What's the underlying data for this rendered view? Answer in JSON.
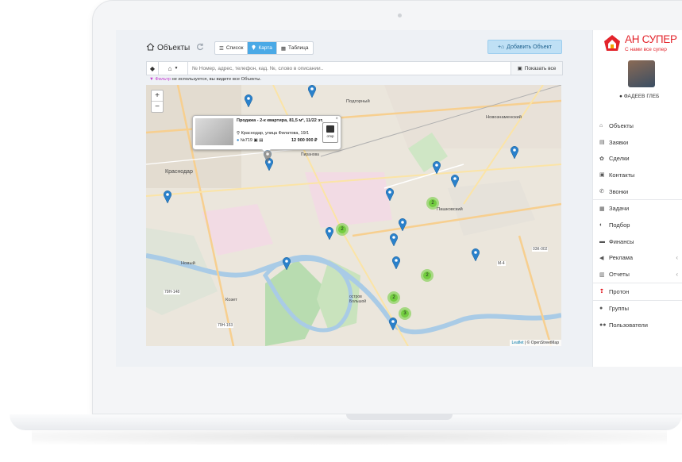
{
  "header": {
    "title": "Объекты",
    "views": [
      {
        "label": "Список"
      },
      {
        "label": "Карта"
      },
      {
        "label": "Таблица"
      }
    ],
    "active_view": "Карта",
    "add_button": "Добавить Объект"
  },
  "search": {
    "placeholder": "№ Номер, адрес, телефон, кад. №, слово в описании..",
    "show_all": "Показать все"
  },
  "filter": {
    "word": "Фильтр",
    "text": "не используется, вы видите все Объекты."
  },
  "map": {
    "zoom_in": "+",
    "zoom_out": "−",
    "attribution_leaflet": "Leaflet",
    "attribution_rest": "| © OpenStreetMap",
    "labels": [
      "Подгорный",
      "Новознаменский",
      "Краснодар",
      "Пашковский",
      "Новый",
      "Козет",
      "остров Большой",
      "Пиранова",
      "М-4",
      "03К-002",
      "79Н-148",
      "79Н-153"
    ],
    "clusters": [
      "2",
      "2",
      "2",
      "2",
      "3"
    ],
    "popup": {
      "title": "Продажа - 2-к квартира, 81,5 м², 11/22 эт.",
      "address": "Краснодар, улица Филатова, 19/1",
      "number": "№719",
      "price": "12 900 000 ₽",
      "badge": "откр",
      "close": "×"
    }
  },
  "sidebar": {
    "logo_title": "АН СУПЕР",
    "logo_subtitle": "С нами все супер",
    "user_name": "ФАДЕЕВ ГЛЕБ",
    "menu": [
      {
        "label": "Объекты",
        "icon": "home-icon"
      },
      {
        "label": "Заявки",
        "icon": "request-icon"
      },
      {
        "label": "Сделки",
        "icon": "deal-icon"
      },
      {
        "label": "Контакты",
        "icon": "contacts-icon"
      },
      {
        "label": "Звонки",
        "icon": "phone-icon"
      },
      {
        "label": "Задачи",
        "icon": "tasks-icon"
      },
      {
        "label": "Подбор",
        "icon": "match-icon"
      },
      {
        "label": "Финансы",
        "icon": "finance-icon"
      },
      {
        "label": "Реклама",
        "icon": "ads-icon"
      },
      {
        "label": "Отчеты",
        "icon": "reports-icon"
      },
      {
        "label": "Протон",
        "icon": "proton-icon"
      },
      {
        "label": "Группы",
        "icon": "groups-icon"
      },
      {
        "label": "Пользователи",
        "icon": "users-icon"
      }
    ]
  },
  "colors": {
    "accent": "#4aa9e6",
    "brand": "#e3242b",
    "pin": "#2a81cb",
    "cluster": "#6ecc39"
  }
}
